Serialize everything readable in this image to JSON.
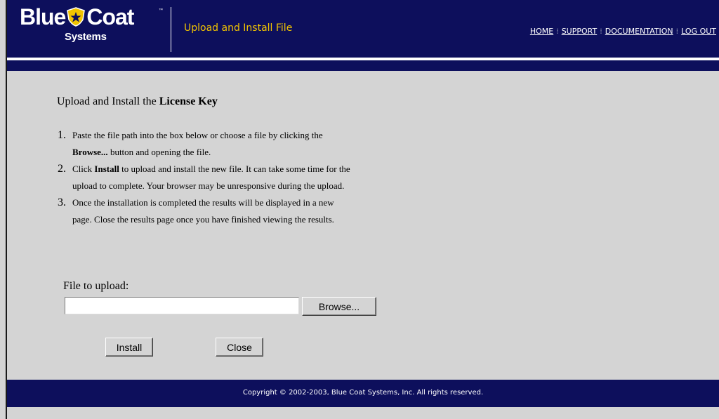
{
  "brand": {
    "name_part1": "Blue",
    "name_part2": "Coat",
    "trademark": "™",
    "subtitle": "Systems",
    "badge_icon": "shield-star-icon"
  },
  "header": {
    "page_title": "Upload and Install File"
  },
  "nav": {
    "items": [
      {
        "label": "HOME"
      },
      {
        "label": "SUPPORT"
      },
      {
        "label": "DOCUMENTATION"
      },
      {
        "label": "LOG OUT"
      }
    ],
    "separator": "⁞"
  },
  "main": {
    "heading_prefix": "Upload and Install the ",
    "heading_bold": "License Key",
    "steps": [
      {
        "number": "1.",
        "text_a": "Paste the file path into the box below or choose a file by clicking the ",
        "bold": "Browse...",
        "text_b": " button and opening the file."
      },
      {
        "number": "2.",
        "text_a": "Click ",
        "bold": "Install",
        "text_b": " to upload and install the new file. It can take some time for the upload to complete. Your browser may be unresponsive during the upload."
      },
      {
        "number": "3.",
        "text_a": "Once the installation is completed the results will be displayed in a new page. Close the results page once you have finished viewing the results.",
        "bold": "",
        "text_b": ""
      }
    ],
    "file_label": "File to upload:",
    "file_value": "",
    "browse_label": "Browse...",
    "install_label": "Install",
    "close_label": "Close"
  },
  "footer": {
    "copyright": "Copyright © 2002-2003, Blue Coat Systems, Inc. All rights reserved."
  },
  "colors": {
    "navy": "#0d0f5c",
    "title_gold": "#f2c400",
    "panel_grey": "#d4d4d4"
  }
}
